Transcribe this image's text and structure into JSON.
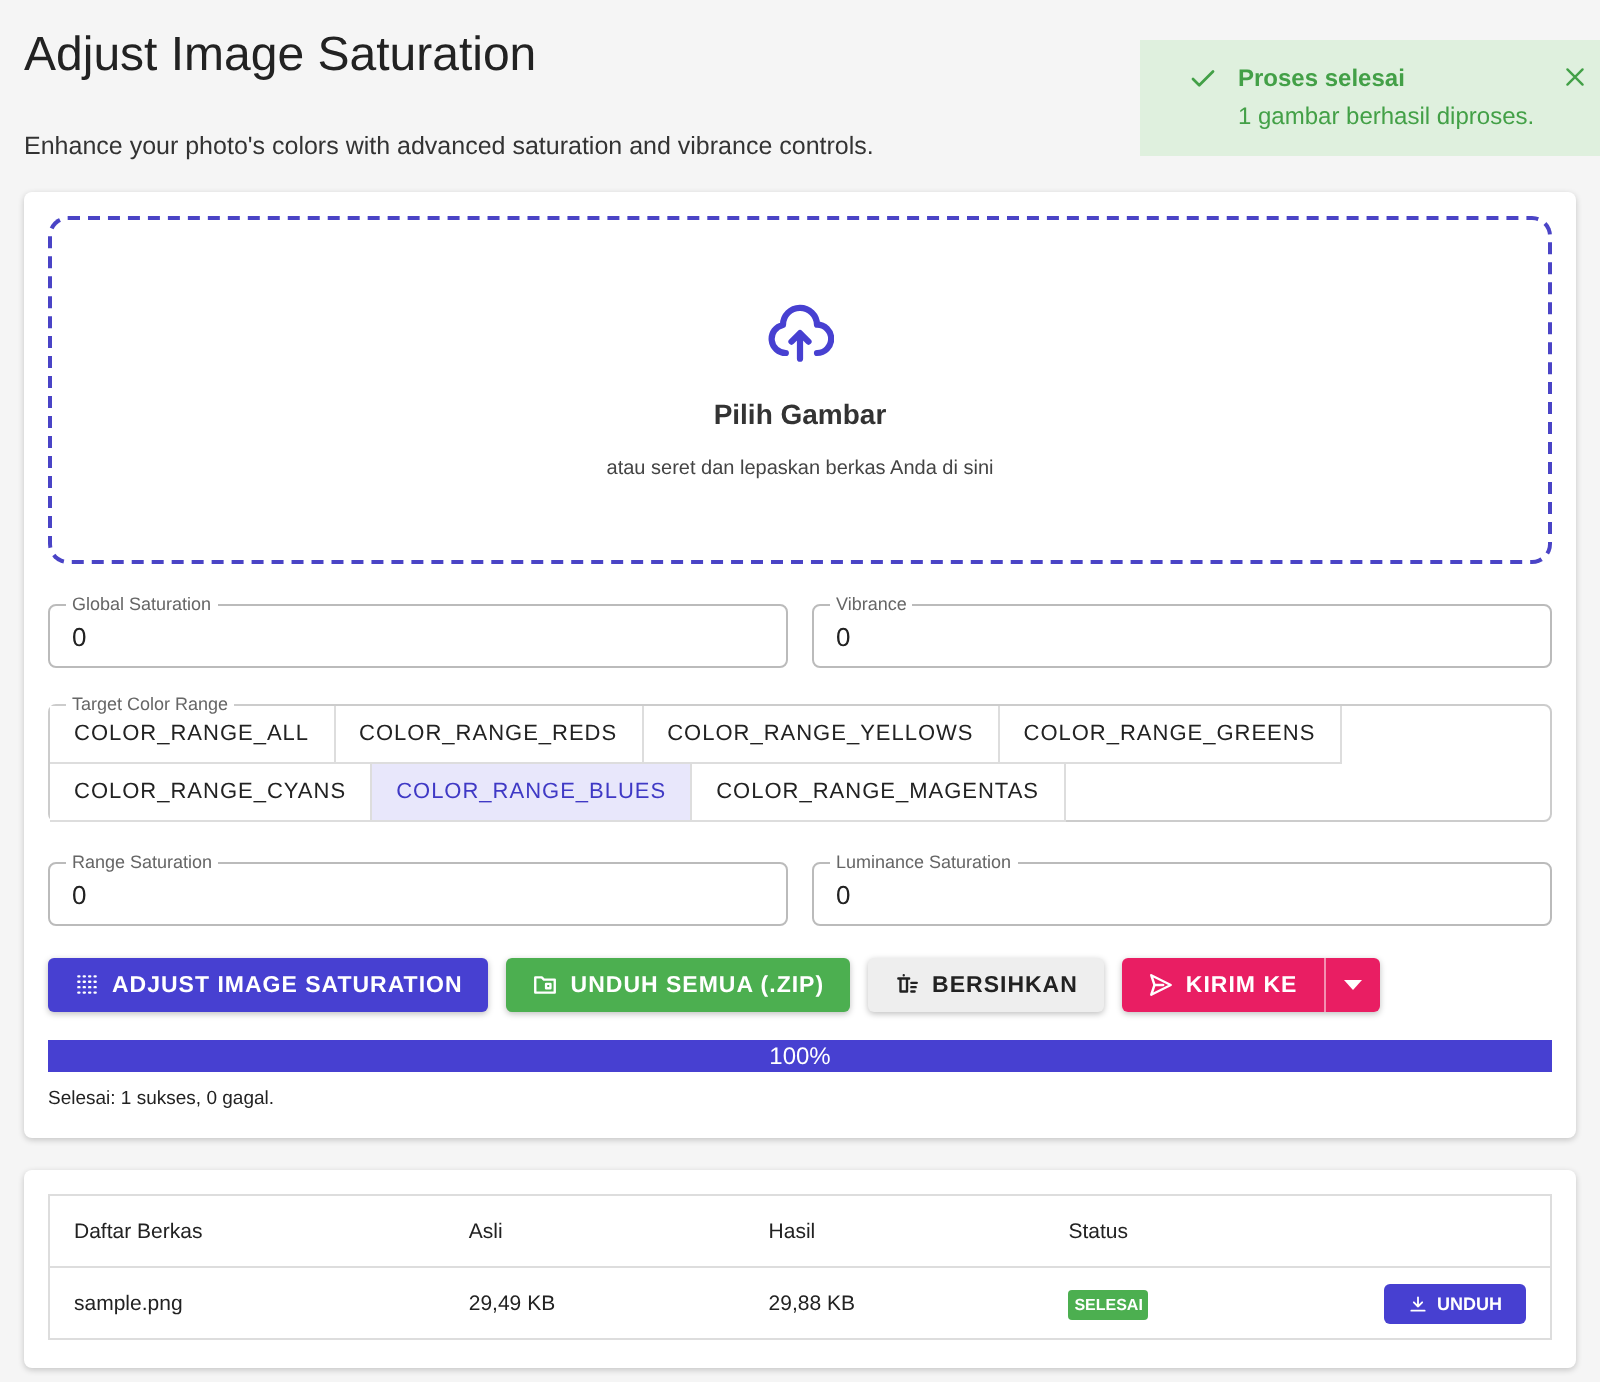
{
  "title": "Adjust Image Saturation",
  "subtitle": "Enhance your photo's colors with advanced saturation and vibrance controls.",
  "toast": {
    "title": "Proses selesai",
    "message": "1 gambar berhasil diproses."
  },
  "dropzone": {
    "title": "Pilih Gambar",
    "hint": "atau seret dan lepaskan berkas Anda di sini"
  },
  "fields_top": [
    {
      "label": "Global Saturation",
      "value": "0"
    },
    {
      "label": "Vibrance",
      "value": "0"
    }
  ],
  "color_range": {
    "label": "Target Color Range",
    "rows": [
      [
        {
          "label": "COLOR_RANGE_ALL",
          "selected": false
        },
        {
          "label": "COLOR_RANGE_REDS",
          "selected": false
        },
        {
          "label": "COLOR_RANGE_YELLOWS",
          "selected": false
        },
        {
          "label": "COLOR_RANGE_GREENS",
          "selected": false
        }
      ],
      [
        {
          "label": "COLOR_RANGE_CYANS",
          "selected": false
        },
        {
          "label": "COLOR_RANGE_BLUES",
          "selected": true
        },
        {
          "label": "COLOR_RANGE_MAGENTAS",
          "selected": false
        }
      ]
    ]
  },
  "fields_bottom": [
    {
      "label": "Range Saturation",
      "value": "0"
    },
    {
      "label": "Luminance Saturation",
      "value": "0"
    }
  ],
  "buttons": [
    {
      "kind": "primary",
      "label": "ADJUST IMAGE SATURATION"
    },
    {
      "kind": "success",
      "label": "UNDUH SEMUA (.ZIP)"
    },
    {
      "kind": "neutral",
      "label": "BERSIHKAN"
    },
    {
      "kind": "split",
      "label": "KIRIM KE"
    }
  ],
  "progress": {
    "level": 1,
    "reading": "100%"
  },
  "summary": "Selesai: 1 sukses, 0 gagal.",
  "table": {
    "columns": [
      "Daftar Berkas",
      "Asli",
      "Hasil",
      "Status"
    ],
    "rows": [
      {
        "name": "sample.png",
        "original": "29,49 KB",
        "result": "29,88 KB",
        "status": "SELESAI",
        "action": "UNDUH"
      }
    ]
  }
}
